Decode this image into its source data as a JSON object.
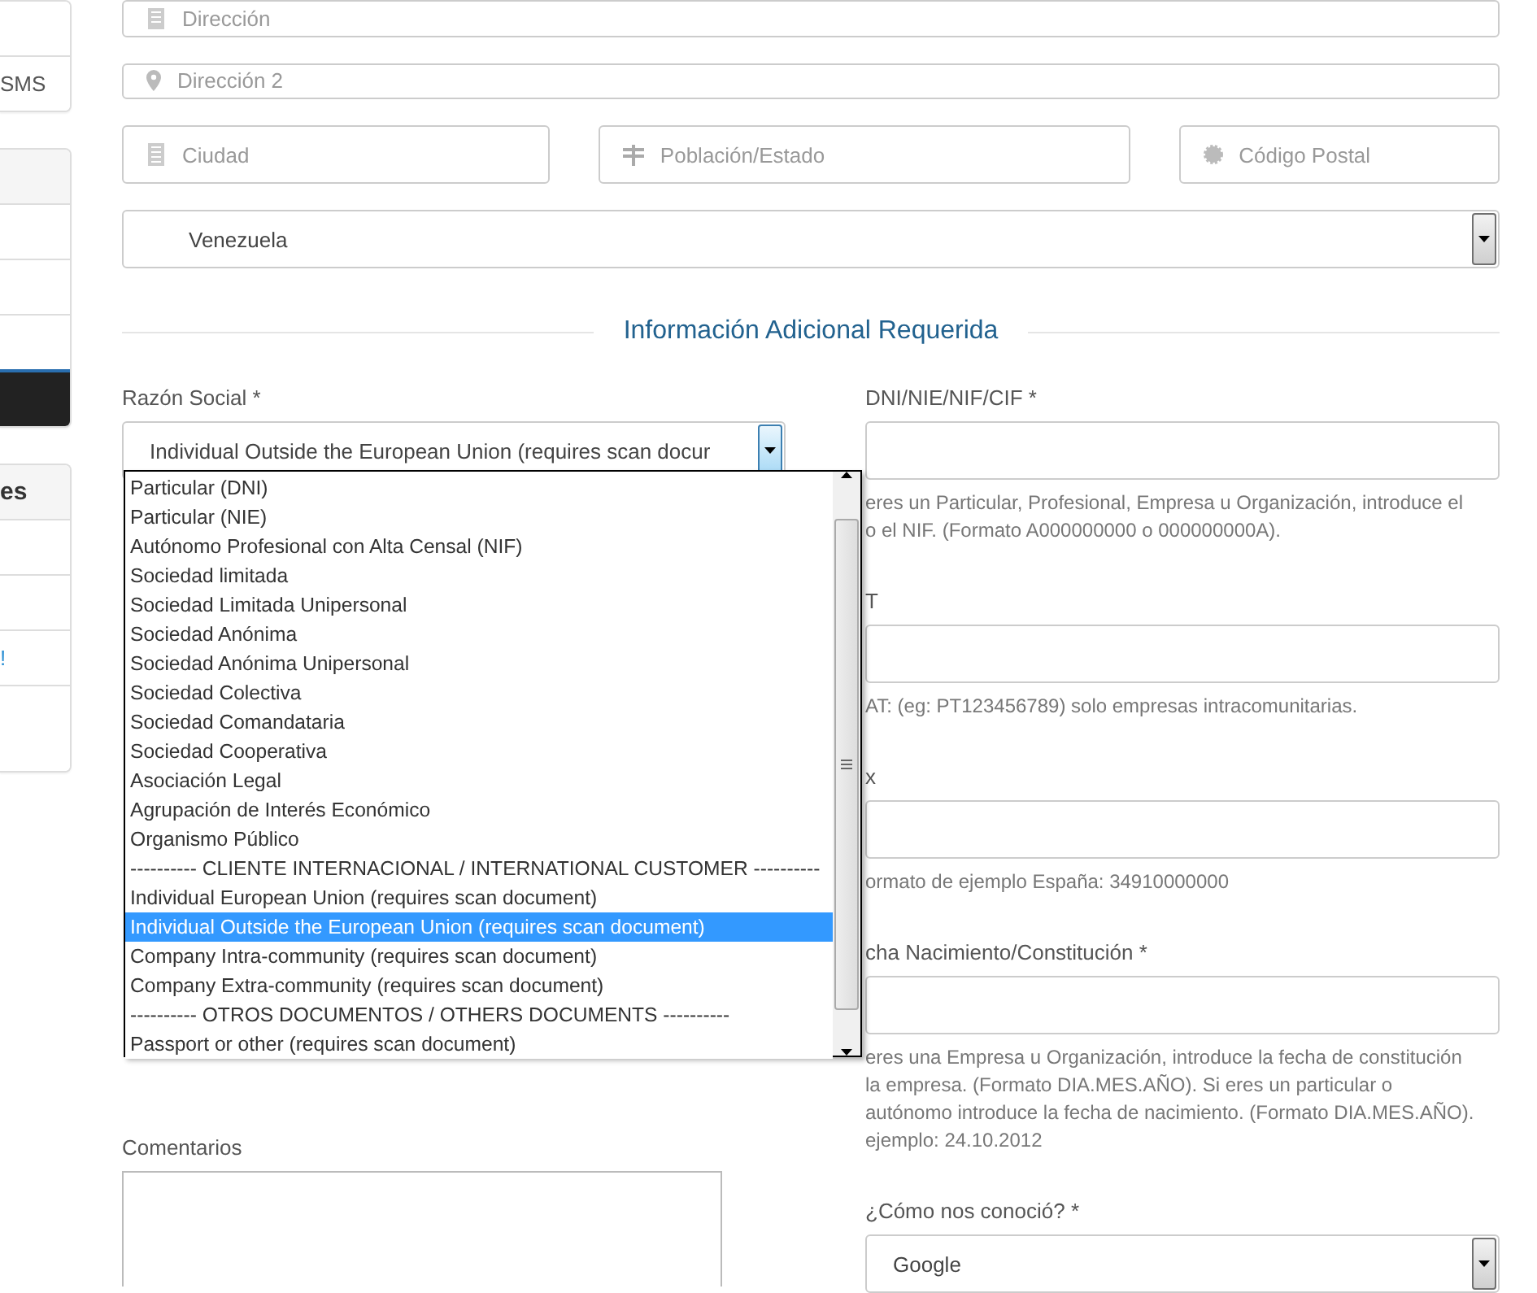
{
  "sidebar": {
    "cards": [
      {
        "items": [
          {
            "kind": "blank"
          },
          {
            "kind": "text",
            "label": "SMS"
          }
        ]
      },
      {
        "items": [
          {
            "kind": "header"
          },
          {
            "kind": "blank"
          },
          {
            "kind": "blank"
          },
          {
            "kind": "blank"
          },
          {
            "kind": "dark"
          }
        ]
      },
      {
        "items": [
          {
            "kind": "header",
            "label": "es"
          },
          {
            "kind": "blank"
          },
          {
            "kind": "blank"
          },
          {
            "kind": "link",
            "label": "!"
          },
          {
            "kind": "tall"
          }
        ]
      }
    ]
  },
  "address_fields": [
    {
      "placeholder": "Dirección"
    },
    {
      "placeholder": "Dirección 2"
    }
  ],
  "location_fields": [
    {
      "placeholder": "Ciudad"
    },
    {
      "placeholder": "Población/Estado"
    },
    {
      "placeholder": "Código Postal"
    }
  ],
  "country_select": {
    "value": "Venezuela"
  },
  "section_title": "Información Adicional Requerida",
  "razon_social": {
    "label": "Razón Social *",
    "value": "Individual Outside the European Union (requires scan docur",
    "open": true,
    "options": [
      {
        "label": "Particular (DNI)",
        "selected": false
      },
      {
        "label": "Particular (NIE)",
        "selected": false
      },
      {
        "label": "Autónomo Profesional con Alta Censal (NIF)",
        "selected": false
      },
      {
        "label": "Sociedad limitada",
        "selected": false
      },
      {
        "label": "Sociedad Limitada Unipersonal",
        "selected": false
      },
      {
        "label": "Sociedad Anónima",
        "selected": false
      },
      {
        "label": "Sociedad Anónima Unipersonal",
        "selected": false
      },
      {
        "label": "Sociedad Colectiva",
        "selected": false
      },
      {
        "label": "Sociedad Comandataria",
        "selected": false
      },
      {
        "label": "Sociedad Cooperativa",
        "selected": false
      },
      {
        "label": "Asociación Legal",
        "selected": false
      },
      {
        "label": "Agrupación de Interés Económico",
        "selected": false
      },
      {
        "label": "Organismo Público",
        "selected": false
      },
      {
        "label": "---------- CLIENTE INTERNACIONAL / INTERNATIONAL CUSTOMER ----------",
        "selected": false
      },
      {
        "label": "Individual European Union (requires scan document)",
        "selected": false
      },
      {
        "label": "Individual Outside the European Union (requires scan document)",
        "selected": true
      },
      {
        "label": "Company Intra-community (requires scan document)",
        "selected": false
      },
      {
        "label": "Company Extra-community (requires scan document)",
        "selected": false
      },
      {
        "label": "---------- OTROS DOCUMENTOS / OTHERS DOCUMENTS ----------",
        "selected": false
      },
      {
        "label": "Passport or other (requires scan document)",
        "selected": false
      }
    ]
  },
  "right_fields": [
    {
      "label": "DNI/NIE/NIF/CIF *",
      "help_lines": [
        "eres un Particular, Profesional, Empresa u Organización, introduce el",
        "o el NIF. (Formato A000000000 o 000000000A)."
      ]
    },
    {
      "label": "T",
      "help_lines": [
        "AT: (eg: PT123456789) solo empresas intracomunitarias."
      ]
    },
    {
      "label": "x",
      "help_lines": [
        "ormato de ejemplo España: 34910000000"
      ]
    },
    {
      "label": "cha Nacimiento/Constitución *",
      "help_lines": [
        "eres una Empresa u Organización, introduce la fecha de constitución",
        "la empresa. (Formato DIA.MES.AÑO). Si eres un particular o",
        "autónomo introduce la fecha de nacimiento. (Formato DIA.MES.AÑO).",
        "ejemplo: 24.10.2012"
      ]
    }
  ],
  "comments": {
    "label": "Comentarios"
  },
  "referral": {
    "label": "¿Cómo nos conoció? *",
    "value": "Google"
  }
}
